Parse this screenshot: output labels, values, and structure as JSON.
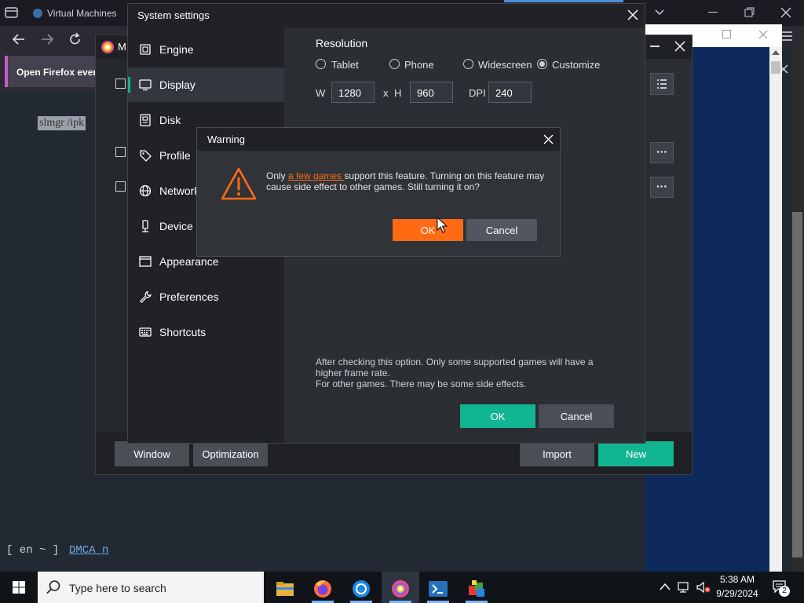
{
  "browser": {
    "tab_title": "Virtual Machines",
    "banner_text": "Open Firefox ever",
    "page_text": "slmgr /ipk",
    "lang_selector": "[ en ~ ]",
    "dmca_link": "DMCA n"
  },
  "memu": {
    "title": "M",
    "bottom_buttons": {
      "window": "Window",
      "optimization": "Optimization",
      "import": "Import",
      "new": "New"
    },
    "more_label": "···"
  },
  "settings": {
    "title": "System settings",
    "sidebar": [
      {
        "label": "Engine",
        "icon": "engine-icon"
      },
      {
        "label": "Display",
        "icon": "monitor-icon",
        "active": true
      },
      {
        "label": "Disk",
        "icon": "disk-icon"
      },
      {
        "label": "Profile",
        "icon": "tag-icon"
      },
      {
        "label": "Network",
        "icon": "globe-icon"
      },
      {
        "label": "Device",
        "icon": "phone-icon"
      },
      {
        "label": "Appearance",
        "icon": "window-icon"
      },
      {
        "label": "Preferences",
        "icon": "wrench-icon"
      },
      {
        "label": "Shortcuts",
        "icon": "keyboard-icon"
      }
    ],
    "resolution": {
      "title": "Resolution",
      "options": [
        {
          "label": "Tablet",
          "selected": false
        },
        {
          "label": "Phone",
          "selected": false
        },
        {
          "label": "Widescreen",
          "selected": false
        },
        {
          "label": "Customize",
          "selected": true
        }
      ],
      "w_label": "W",
      "w_value": "1280",
      "x_label": "x",
      "h_label": "H",
      "h_value": "960",
      "dpi_label": "DPI",
      "dpi_value": "240"
    },
    "description_line1": "After checking this option. Only some supported games will have a higher frame rate.",
    "description_line2": "For other games. There may be some side effects.",
    "ok_label": "OK",
    "cancel_label": "Cancel"
  },
  "warning": {
    "title": "Warning",
    "msg_before": "Only ",
    "msg_link": "a few games ",
    "msg_after": "support this feature. Turning on this feature may cause side effect to other games. Still turning it on?",
    "ok_label": "OK",
    "cancel_label": "Cancel"
  },
  "taskbar": {
    "search_placeholder": "Type here to search",
    "time": "5:38 AM",
    "date": "9/29/2024",
    "notification_count": "2",
    "apps": [
      "file-explorer-icon",
      "firefox-icon",
      "chrome-icon",
      "memu-icon",
      "powershell-icon",
      "memu-multi-icon"
    ]
  },
  "colors": {
    "accent_teal": "#12b592",
    "warning_orange": "#ff6a13"
  }
}
